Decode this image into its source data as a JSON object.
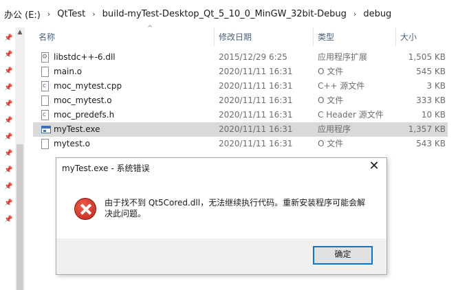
{
  "breadcrumb": [
    "办公 (E:)",
    "QtTest",
    "build-myTest-Desktop_Qt_5_10_0_MinGW_32bit-Debug",
    "debug"
  ],
  "columns": {
    "name": "名称",
    "date": "修改日期",
    "type": "类型",
    "size": "大小"
  },
  "files": [
    {
      "name": "libstdc++-6.dll",
      "date": "2015/12/29 6:25",
      "type": "应用程序扩展",
      "size": "1,505 KB",
      "icon": "dll-file-icon"
    },
    {
      "name": "main.o",
      "date": "2020/11/11 16:31",
      "type": "O 文件",
      "size": "545 KB",
      "icon": "file-icon"
    },
    {
      "name": "moc_mytest.cpp",
      "date": "2020/11/11 16:31",
      "type": "C++ 源文件",
      "size": "3 KB",
      "icon": "cpp-file-icon"
    },
    {
      "name": "moc_mytest.o",
      "date": "2020/11/11 16:31",
      "type": "O 文件",
      "size": "333 KB",
      "icon": "file-icon"
    },
    {
      "name": "moc_predefs.h",
      "date": "2020/11/11 16:31",
      "type": "C Header 源文件",
      "size": "10 KB",
      "icon": "header-file-icon"
    },
    {
      "name": "myTest.exe",
      "date": "2020/11/11 16:31",
      "type": "应用程序",
      "size": "1,357 KB",
      "icon": "exe-file-icon",
      "selected": true
    },
    {
      "name": "mytest.o",
      "date": "2020/11/11 16:31",
      "type": "O 文件",
      "size": "543 KB",
      "icon": "file-icon"
    }
  ],
  "dialog": {
    "title": "myTest.exe - 系统错误",
    "message": "由于找不到 Qt5Cored.dll，无法继续执行代码。重新安装程序可能会解决此问题。",
    "ok_label": "确定"
  },
  "colors": {
    "selection": "#d9d9d9",
    "accent": "#0078d7",
    "header_text": "#4c607a"
  }
}
